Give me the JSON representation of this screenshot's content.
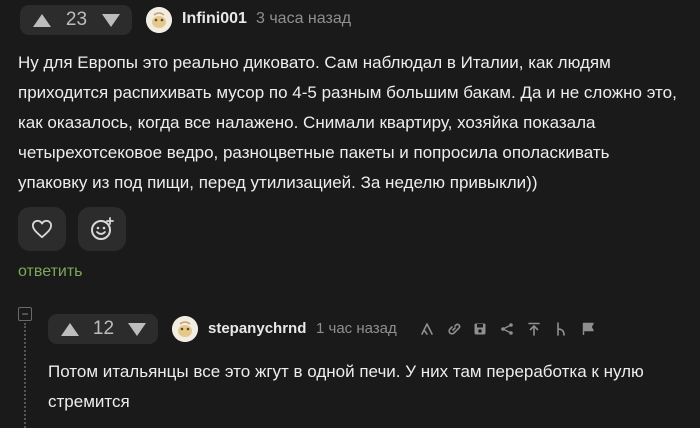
{
  "comment1": {
    "score": "23",
    "username": "Infini001",
    "time": "3 часа назад",
    "text": "Ну для Европы это реально диковато. Сам наблюдал в Италии, как людям приходится распихивать мусор по 4-5 разным большим бакам. Да и не сложно это, как оказалось, когда все налажено. Снимали квартиру, хозяйка показала четырехотсековое ведро, разноцветные пакеты и попросила ополаскивать упаковку из под пищи, перед утилизацией. За неделю привыкли))",
    "reply_label": "ответить",
    "icons": [
      "heart-icon",
      "add-emoji-icon"
    ]
  },
  "comment2": {
    "score": "12",
    "username": "stepanychrnd",
    "time": "1 час назад",
    "text": "Потом итальянцы все это жгут в одной печи. У них там переработка к нулю стремится",
    "toolbar_icons": [
      "branch-icon",
      "link-icon",
      "save-icon",
      "share-icon",
      "jump-up-icon",
      "parent-icon",
      "report-flag-icon"
    ]
  },
  "thread": {
    "collapse_symbol": "−"
  },
  "colors": {
    "background": "#1a1a1a",
    "pill": "#2c2c2c",
    "reply_link": "#7ba85a",
    "muted": "#8f8f8f"
  }
}
